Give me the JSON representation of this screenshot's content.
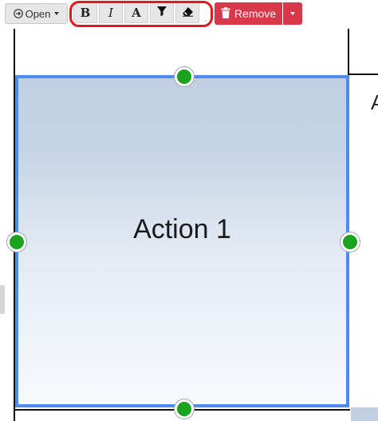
{
  "toolbar": {
    "open_label": "Open",
    "format_buttons": {
      "bold": "B",
      "italic": "I",
      "font": "A"
    },
    "remove_label": "Remove",
    "colors": {
      "remove": "#d9374a",
      "highlight_outline": "#e8151b"
    }
  },
  "canvas": {
    "shape": {
      "label": "Action 1",
      "border_color": "#4a8cf0",
      "handle_color": "#1aa31c"
    },
    "adjacent_shape_text": "A"
  }
}
